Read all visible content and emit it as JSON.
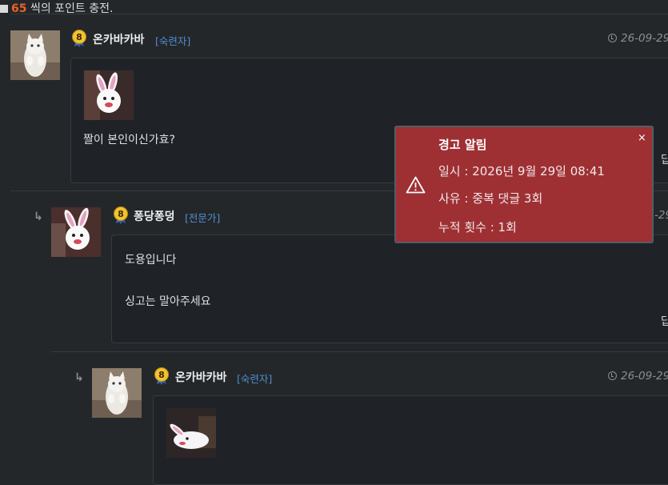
{
  "top": {
    "count": "65",
    "text_suffix": "씩의 포인트 충전."
  },
  "comments": [
    {
      "nickname": "온카바카바",
      "level": "8",
      "rank": "[숙련자]",
      "date": "26-09-29",
      "body": "짤이 본인이신가효?",
      "reply_label": "답"
    },
    {
      "nickname": "퐁당퐁덩",
      "level": "8",
      "rank": "[전문가]",
      "date": "-29",
      "body_lines": [
        "도용입니다",
        "싱고는 말아주세요"
      ],
      "reply_label": "답",
      "reply_arrow": "↳"
    },
    {
      "nickname": "온카바카바",
      "level": "8",
      "rank": "[숙련자]",
      "date": "26-09-29",
      "reply_arrow": "↳"
    }
  ],
  "alert": {
    "title": "경고 알림",
    "close": "×",
    "datetime": "일시 : 2026년 9월 29일 08:41",
    "reason": "사유 : 중복 댓글 3회",
    "count": "누적 횟수 : 1회"
  },
  "colors": {
    "background": "#24272a",
    "alert_bg": "#9e3034",
    "rank_blue": "#4f8fd0",
    "level_badge": "#f2c232"
  }
}
